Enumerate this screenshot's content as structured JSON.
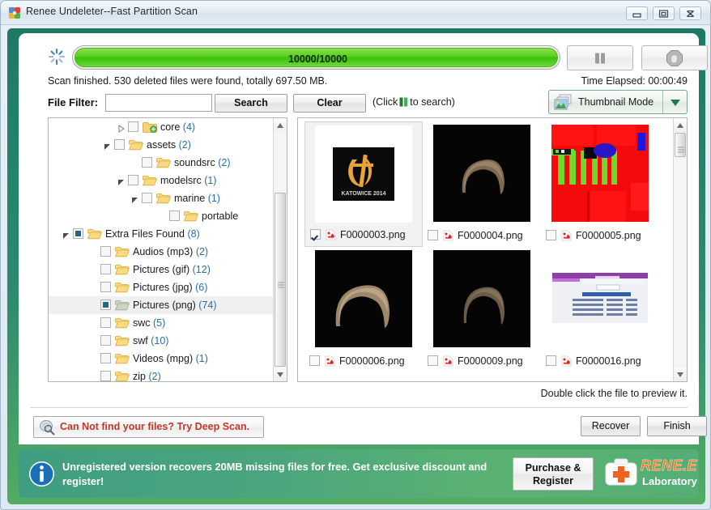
{
  "window": {
    "title": "Renee Undeleter--Fast Partition Scan",
    "app_icon": "app-puzzle-icon",
    "controls": {
      "minimize": "minimize-icon",
      "maximize": "maximize-icon",
      "close": "close-icon"
    }
  },
  "progress": {
    "spinner_icon": "loading-spinner-icon",
    "value_text": "10000/10000",
    "percent": 100,
    "pause_label": "pause-icon",
    "stop_label": "stop-icon",
    "status": "Scan finished. 530 deleted files were found, totally 697.50 MB.",
    "time_elapsed": "Time Elapsed: 00:00:49"
  },
  "filter": {
    "label": "File  Filter:",
    "value": "",
    "placeholder": "",
    "search_label": "Search",
    "clear_label": "Clear",
    "hint_prefix": "(Click",
    "hint_suffix": "to search)"
  },
  "view_mode": {
    "icon": "thumbnail-mode-icon",
    "label": "Thumbnail Mode",
    "arrow": "chevron-down-icon"
  },
  "tree": {
    "items": [
      {
        "label": "core",
        "count": "(4)",
        "indent": 5,
        "arrow": "collapsed",
        "check": "empty",
        "folder": "folder-new",
        "selected": false
      },
      {
        "label": "assets",
        "count": "(2)",
        "indent": 4,
        "arrow": "expanded",
        "check": "empty",
        "folder": "folder-open",
        "selected": false
      },
      {
        "label": "soundsrc",
        "count": "(2)",
        "indent": 6,
        "arrow": "none",
        "check": "empty",
        "folder": "folder-open",
        "selected": false
      },
      {
        "label": "modelsrc",
        "count": "(1)",
        "indent": 5,
        "arrow": "expanded",
        "check": "empty",
        "folder": "folder-open",
        "selected": false
      },
      {
        "label": "marine",
        "count": "(1)",
        "indent": 6,
        "arrow": "expanded",
        "check": "empty",
        "folder": "folder-open",
        "selected": false
      },
      {
        "label": "portable",
        "count": "",
        "indent": 8,
        "arrow": "none",
        "check": "empty",
        "folder": "folder-open",
        "selected": false
      },
      {
        "label": "Extra Files Found",
        "count": "(8)",
        "indent": 1,
        "arrow": "expanded",
        "check": "partial",
        "folder": "folder-open",
        "selected": false
      },
      {
        "label": "Audios (mp3)",
        "count": "(2)",
        "indent": 3,
        "arrow": "none",
        "check": "empty",
        "folder": "folder-open",
        "selected": false
      },
      {
        "label": "Pictures (gif)",
        "count": "(12)",
        "indent": 3,
        "arrow": "none",
        "check": "empty",
        "folder": "folder-open",
        "selected": false
      },
      {
        "label": "Pictures (jpg)",
        "count": "(6)",
        "indent": 3,
        "arrow": "none",
        "check": "empty",
        "folder": "folder-open",
        "selected": false
      },
      {
        "label": "Pictures (png)",
        "count": "(74)",
        "indent": 3,
        "arrow": "none",
        "check": "partial",
        "folder": "folder-open-gray",
        "selected": true
      },
      {
        "label": "swc",
        "count": "(5)",
        "indent": 3,
        "arrow": "none",
        "check": "empty",
        "folder": "folder-open",
        "selected": false
      },
      {
        "label": "swf",
        "count": "(10)",
        "indent": 3,
        "arrow": "none",
        "check": "empty",
        "folder": "folder-open",
        "selected": false
      },
      {
        "label": "Videos (mpg)",
        "count": "(1)",
        "indent": 3,
        "arrow": "none",
        "check": "empty",
        "folder": "folder-open",
        "selected": false
      },
      {
        "label": "zip",
        "count": "(2)",
        "indent": 3,
        "arrow": "none",
        "check": "empty",
        "folder": "folder-open",
        "selected": false
      }
    ]
  },
  "thumbnails": {
    "items": [
      {
        "name": "F0000003.png",
        "checked": true,
        "selected": true,
        "art": "fnatic-logo"
      },
      {
        "name": "F0000004.png",
        "checked": false,
        "selected": false,
        "art": "hair-dark"
      },
      {
        "name": "F0000005.png",
        "checked": false,
        "selected": false,
        "art": "red-texture"
      },
      {
        "name": "F0000006.png",
        "checked": false,
        "selected": false,
        "art": "hair-light"
      },
      {
        "name": "F0000009.png",
        "checked": false,
        "selected": false,
        "art": "hair-dim"
      },
      {
        "name": "F0000016.png",
        "checked": false,
        "selected": false,
        "art": "webpage"
      }
    ],
    "file_icon": "png-file-icon"
  },
  "footer": {
    "preview_hint": "Double click the file to preview it.",
    "deep_scan_icon": "disk-search-icon",
    "deep_scan_text": "Can Not find your files?  Try Deep Scan.",
    "recover_label": "Recover",
    "finish_label": "Finish"
  },
  "banner": {
    "info_icon": "info-icon",
    "message": "Unregistered version recovers 20MB missing files for free. Get exclusive discount and register!",
    "purchase_label_line1": "Purchase &",
    "purchase_label_line2": "Register",
    "logo_icon": "first-aid-case-icon",
    "logo_title": "RENE.E",
    "logo_subtitle": "Laboratory"
  },
  "colors": {
    "frame_green": "#1e7a68",
    "progress_green": "#3cc209",
    "accent_blue": "#2b6da8",
    "warning_red": "#c0392b",
    "logo_orange": "#f07b22"
  }
}
